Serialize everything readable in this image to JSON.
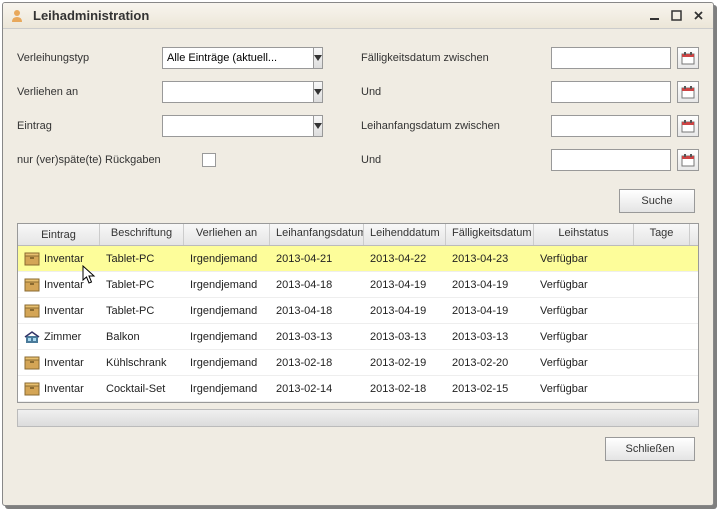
{
  "window": {
    "title": "Leihadministration"
  },
  "form": {
    "left": {
      "type_label": "Verleihungstyp",
      "type_value": "Alle Einträge (aktuell...",
      "loaned_label": "Verliehen an",
      "entry_label": "Eintrag",
      "overdue_label": "nur (ver)späte(te) Rückgaben"
    },
    "right": {
      "due_label": "Fälligkeitsdatum zwischen",
      "and1_label": "Und",
      "start_label": "Leihanfangsdatum zwischen",
      "and2_label": "Und"
    },
    "search_btn": "Suche",
    "close_btn": "Schließen"
  },
  "grid": {
    "headers": [
      "Eintrag",
      "Beschriftung",
      "Verliehen an",
      "Leihanfangsdatum",
      "Leihenddatum",
      "Fälligkeitsdatum",
      "Leihstatus",
      "Tage"
    ],
    "rows": [
      {
        "icon": "box",
        "c0": "Inventar",
        "c1": "Tablet-PC",
        "c2": "Irgendjemand",
        "c3": "2013-04-21",
        "c4": "2013-04-22",
        "c5": "2013-04-23",
        "c6": "Verfügbar",
        "c7": "",
        "sel": true
      },
      {
        "icon": "box",
        "c0": "Inventar",
        "c1": "Tablet-PC",
        "c2": "Irgendjemand",
        "c3": "2013-04-18",
        "c4": "2013-04-19",
        "c5": "2013-04-19",
        "c6": "Verfügbar",
        "c7": ""
      },
      {
        "icon": "box",
        "c0": "Inventar",
        "c1": "Tablet-PC",
        "c2": "Irgendjemand",
        "c3": "2013-04-18",
        "c4": "2013-04-19",
        "c5": "2013-04-19",
        "c6": "Verfügbar",
        "c7": ""
      },
      {
        "icon": "room",
        "c0": "Zimmer",
        "c1": "Balkon",
        "c2": "Irgendjemand",
        "c3": "2013-03-13",
        "c4": "2013-03-13",
        "c5": "2013-03-13",
        "c6": "Verfügbar",
        "c7": ""
      },
      {
        "icon": "box",
        "c0": "Inventar",
        "c1": "Kühlschrank",
        "c2": "Irgendjemand",
        "c3": "2013-02-18",
        "c4": "2013-02-19",
        "c5": "2013-02-20",
        "c6": "Verfügbar",
        "c7": ""
      },
      {
        "icon": "box",
        "c0": "Inventar",
        "c1": "Cocktail-Set",
        "c2": "Irgendjemand",
        "c3": "2013-02-14",
        "c4": "2013-02-18",
        "c5": "2013-02-15",
        "c6": "Verfügbar",
        "c7": ""
      }
    ]
  }
}
